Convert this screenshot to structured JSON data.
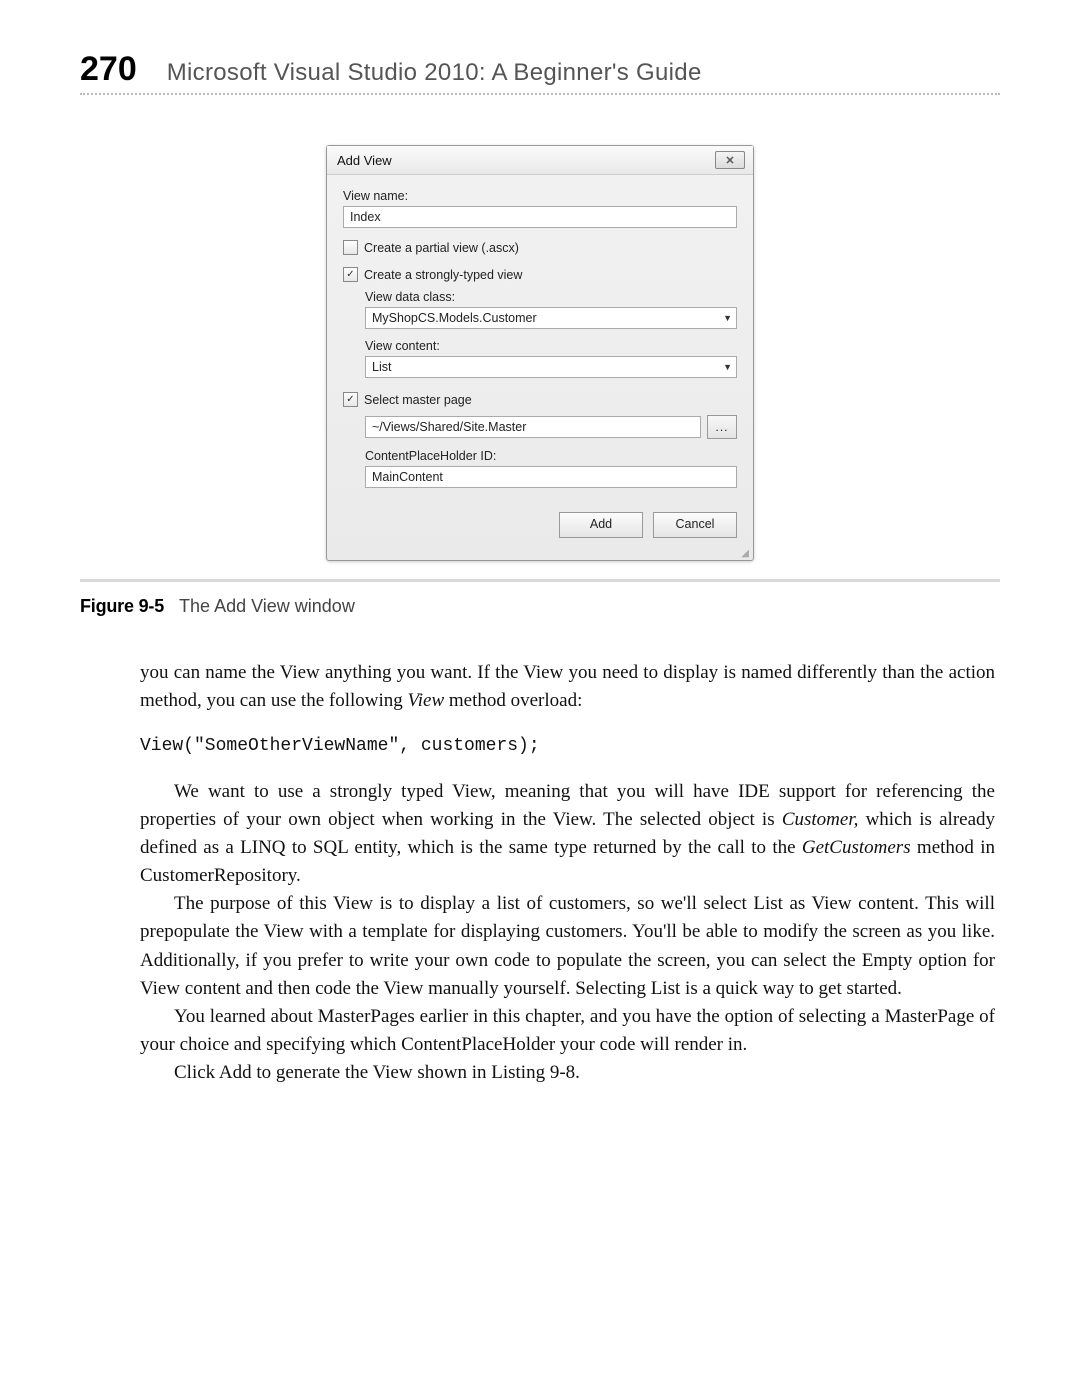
{
  "header": {
    "page_number": "270",
    "running_title": "Microsoft Visual Studio 2010: A Beginner's Guide"
  },
  "dialog": {
    "title": "Add View",
    "close_glyph": "✕",
    "view_name_label": "View name:",
    "view_name_value": "Index",
    "cb_partial_label": "Create a partial view (.ascx)",
    "cb_strong_label": "Create a strongly-typed view",
    "view_data_class_label": "View data class:",
    "view_data_class_value": "MyShopCS.Models.Customer",
    "view_content_label": "View content:",
    "view_content_value": "List",
    "cb_master_label": "Select master page",
    "master_value": "~/Views/Shared/Site.Master",
    "browse_label": "...",
    "cph_label": "ContentPlaceHolder ID:",
    "cph_value": "MainContent",
    "add_btn": "Add",
    "cancel_btn": "Cancel",
    "checkmark": "✓"
  },
  "caption": {
    "label": "Figure 9-5",
    "text": "The Add View window"
  },
  "body": {
    "p1a": "you can name the View anything you want. If the View you need to display is named differently than the action method, you can use the following ",
    "p1b": "View",
    "p1c": " method overload:",
    "code": "View(\"SomeOtherViewName\", customers);",
    "p2a": "We want to use a strongly typed View, meaning that you will have IDE support for referencing the properties of your own object when working in the View. The selected object is ",
    "p2b": "Customer,",
    "p2c": " which is already defined as a LINQ to SQL entity, which is the same type returned by the call to the ",
    "p2d": "GetCustomers",
    "p2e": " method in CustomerRepository.",
    "p3": "The purpose of this View is to display a list of customers, so we'll select List as View content. This will prepopulate the View with a template for displaying customers. You'll be able to modify the screen as you like. Additionally, if you prefer to write your own code to populate the screen, you can select the Empty option for View content and then code the View manually yourself. Selecting List is a quick way to get started.",
    "p4": "You learned about MasterPages earlier in this chapter, and you have the option of selecting a MasterPage of your choice and specifying which ContentPlaceHolder your code will render in.",
    "p5": "Click Add to generate the View shown in Listing 9-8."
  }
}
